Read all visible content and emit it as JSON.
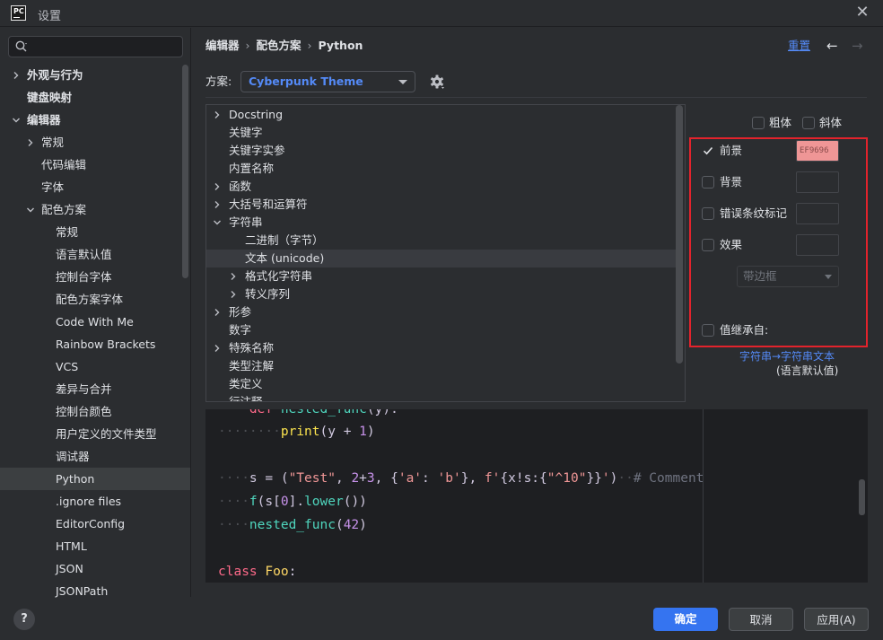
{
  "window": {
    "logo_text": "PC",
    "title": "设置",
    "close_glyph": "✕"
  },
  "sidebar": {
    "search_placeholder": "",
    "items": [
      {
        "label": "外观与行为",
        "expandable": true,
        "expanded": false
      },
      {
        "label": "键盘映射"
      },
      {
        "label": "编辑器",
        "expandable": true,
        "expanded": true
      },
      {
        "label": "常规",
        "expandable": true,
        "expanded": false
      },
      {
        "label": "代码编辑"
      },
      {
        "label": "字体"
      },
      {
        "label": "配色方案",
        "expandable": true,
        "expanded": true
      },
      {
        "label": "常规"
      },
      {
        "label": "语言默认值"
      },
      {
        "label": "控制台字体"
      },
      {
        "label": "配色方案字体"
      },
      {
        "label": "Code With Me"
      },
      {
        "label": "Rainbow Brackets"
      },
      {
        "label": "VCS"
      },
      {
        "label": "差异与合并"
      },
      {
        "label": "控制台颜色"
      },
      {
        "label": "用户定义的文件类型"
      },
      {
        "label": "调试器"
      },
      {
        "label": "Python",
        "selected": true
      },
      {
        "label": ".ignore files"
      },
      {
        "label": "EditorConfig"
      },
      {
        "label": "HTML"
      },
      {
        "label": "JSON"
      },
      {
        "label": "JSONPath"
      }
    ]
  },
  "breadcrumb": {
    "parts": [
      "编辑器",
      "配色方案",
      "Python"
    ],
    "separator": "›"
  },
  "header": {
    "reset_label": "重置",
    "back_glyph": "←",
    "forward_glyph": "→"
  },
  "scheme": {
    "label": "方案:",
    "value": "Cyberpunk Theme"
  },
  "element_tree": [
    {
      "label": "Docstring",
      "expandable": true
    },
    {
      "label": "关键字"
    },
    {
      "label": "关键字实参"
    },
    {
      "label": "内置名称"
    },
    {
      "label": "函数",
      "expandable": true
    },
    {
      "label": "大括号和运算符",
      "expandable": true
    },
    {
      "label": "字符串",
      "expandable": true,
      "expanded": true
    },
    {
      "label": "二进制（字节）",
      "child": true
    },
    {
      "label": "文本 (unicode)",
      "child": true,
      "selected": true
    },
    {
      "label": "格式化字符串",
      "child": true,
      "expandable": true
    },
    {
      "label": "转义序列",
      "child": true,
      "expandable": true
    },
    {
      "label": "形参",
      "expandable": true
    },
    {
      "label": "数字"
    },
    {
      "label": "特殊名称",
      "expandable": true
    },
    {
      "label": "类型注解"
    },
    {
      "label": "类定义"
    },
    {
      "label": "行注释"
    }
  ],
  "options": {
    "bold_label": "粗体",
    "italic_label": "斜体",
    "foreground_label": "前景",
    "foreground_checked": true,
    "foreground_color": "EF9696",
    "background_label": "背景",
    "error_stripe_label": "错误条纹标记",
    "effects_label": "效果",
    "effect_type": "带边框",
    "inherit_label": "值继承自:",
    "inherit_link": "字符串→字符串文本",
    "inherit_note": "(语言默认值)"
  },
  "code": {
    "partial_first_line": "def nested_func(y):",
    "lines": [
      {
        "indent": "········",
        "parts": [
          [
            "fnc",
            "print"
          ],
          [
            "pl",
            "(y "
          ],
          [
            "pl",
            "+ "
          ],
          [
            "num",
            "1"
          ],
          [
            "pl",
            ")"
          ]
        ]
      },
      {
        "indent": "",
        "parts": []
      },
      {
        "indent": "····",
        "parts": [
          [
            "pl",
            "s = ("
          ],
          [
            "str",
            "\"Test\""
          ],
          [
            "pl",
            ", "
          ],
          [
            "num",
            "2"
          ],
          [
            "pl",
            "+"
          ],
          [
            "num",
            "3"
          ],
          [
            "pl",
            ", {"
          ],
          [
            "str",
            "'a'"
          ],
          [
            "pl",
            ": "
          ],
          [
            "str",
            "'b'"
          ],
          [
            "pl",
            "}, "
          ],
          [
            "str",
            "f'"
          ],
          [
            "pl",
            "{x!s:{"
          ],
          [
            "str",
            "\"^10\""
          ],
          [
            "pl",
            "}}"
          ],
          [
            "str",
            "'"
          ],
          [
            "pl",
            ")"
          ],
          [
            "ws",
            "··"
          ],
          [
            "cm",
            "# Comment"
          ]
        ]
      },
      {
        "indent": "····",
        "parts": [
          [
            "fn",
            "f"
          ],
          [
            "pl",
            "(s["
          ],
          [
            "num",
            "0"
          ],
          [
            "pl",
            "]."
          ],
          [
            "fn",
            "lower"
          ],
          [
            "pl",
            "())"
          ]
        ]
      },
      {
        "indent": "····",
        "parts": [
          [
            "fn",
            "nested_func"
          ],
          [
            "pl",
            "("
          ],
          [
            "num",
            "42"
          ],
          [
            "pl",
            ")"
          ]
        ]
      },
      {
        "indent": "",
        "parts": []
      },
      {
        "indent": "",
        "parts": [
          [
            "kw",
            "class "
          ],
          [
            "cls",
            "Foo"
          ],
          [
            "pl",
            ":"
          ]
        ]
      }
    ]
  },
  "footer": {
    "help_label": "?",
    "ok_label": "确定",
    "cancel_label": "取消",
    "apply_label": "应用(A)"
  },
  "colors": {
    "accent": "#3574f0",
    "link": "#548af7",
    "highlight_box": "#e3232c",
    "foreground_swatch": "#ef9696"
  }
}
